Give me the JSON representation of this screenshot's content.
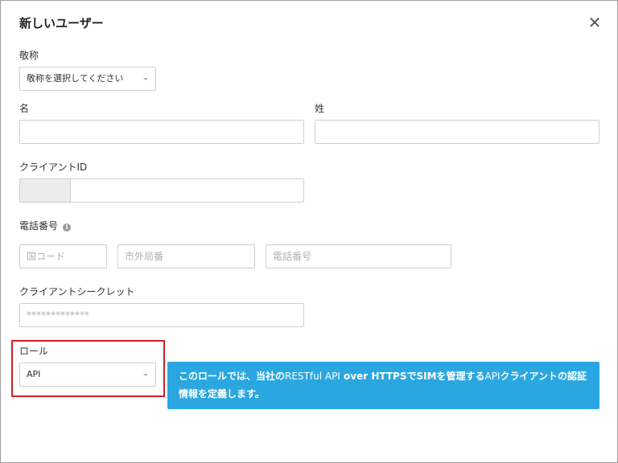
{
  "dialog": {
    "title": "新しいユーザー",
    "close_icon": "close-icon"
  },
  "salutation": {
    "label": "敬称",
    "selected": "敬称を選択してください"
  },
  "first_name": {
    "label": "名",
    "value": ""
  },
  "last_name": {
    "label": "姓",
    "value": ""
  },
  "client_id": {
    "label": "クライアントID",
    "prefix": "",
    "value": ""
  },
  "phone": {
    "label": "電話番号",
    "info_icon": "info-icon",
    "country_code_placeholder": "国コード",
    "area_code_placeholder": "市外局番",
    "number_placeholder": "電話番号"
  },
  "client_secret": {
    "label": "クライアントシークレット",
    "placeholder": "*************"
  },
  "role": {
    "label": "ロール",
    "selected": "API"
  },
  "info_banner": {
    "part1": "このロールでは、当社の",
    "part2": "RESTful API",
    "part3": " over HTTPSでSIMを管理する",
    "part4": "API",
    "part5": "クライアントの認証情報を定義します。"
  },
  "colors": {
    "banner_bg": "#2aa7e0",
    "highlight_border": "#d32020"
  }
}
